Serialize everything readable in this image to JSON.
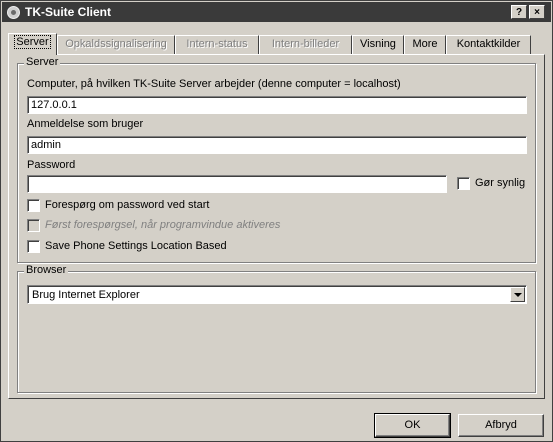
{
  "window": {
    "title": "TK-Suite Client",
    "help_label": "?",
    "close_label": "×"
  },
  "tabs": [
    {
      "label": "Server",
      "state": "active"
    },
    {
      "label": "Opkaldssignalisering",
      "state": "disabled"
    },
    {
      "label": "Intern-status",
      "state": "disabled"
    },
    {
      "label": "Intern-billeder",
      "state": "disabled"
    },
    {
      "label": "Visning",
      "state": "enabled"
    },
    {
      "label": "More",
      "state": "enabled"
    },
    {
      "label": "Kontaktkilder",
      "state": "enabled"
    }
  ],
  "server_group": {
    "title": "Server",
    "computer_label": "Computer, på hvilken TK-Suite Server arbejder (denne computer = localhost)",
    "computer_value": "127.0.0.1",
    "login_label": "Anmeldelse som bruger",
    "login_value": "admin",
    "password_label": "Password",
    "password_value": "",
    "show_password_label": "Gør synlig",
    "ask_password_label": "Forespørg om password ved start",
    "first_request_label": "Først forespørgsel, når programvindue aktiveres",
    "save_phone_label": "Save Phone Settings Location Based"
  },
  "browser_group": {
    "title": "Browser",
    "selected": "Brug Internet Explorer"
  },
  "buttons": {
    "ok": "OK",
    "cancel": "Afbryd"
  }
}
